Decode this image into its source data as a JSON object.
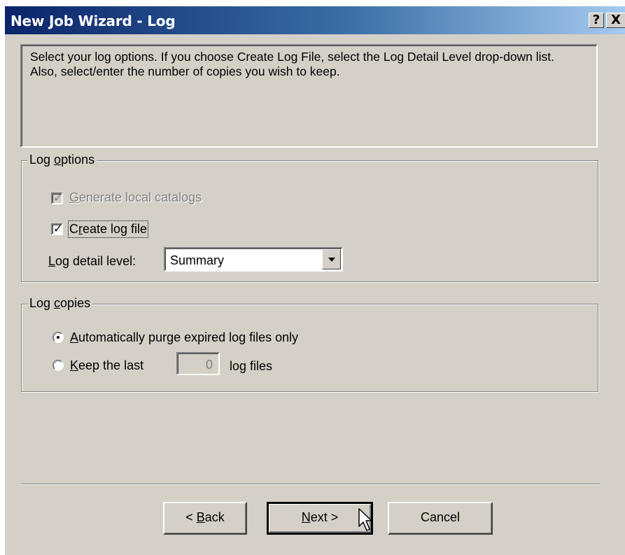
{
  "window": {
    "title": "New Job Wizard - Log",
    "help_label": "?",
    "close_label": "X"
  },
  "info": {
    "text": "Select your log options. If you choose Create Log File, select the Log Detail Level drop-down list.\nAlso, select/enter the number of copies you wish to keep."
  },
  "log_options": {
    "legend": "Log options",
    "generate_catalogs": {
      "label": "Generate local catalogs",
      "checked": true,
      "disabled": true
    },
    "create_log_file": {
      "label": "Create log file",
      "checked": true
    },
    "detail_level_label": "Log detail level:",
    "detail_level_value": "Summary"
  },
  "log_copies": {
    "legend": "Log copies",
    "option_purge": {
      "label": "Automatically purge expired log files only",
      "selected": true
    },
    "option_keep_prefix": "Keep the last",
    "keep_count": "0",
    "option_keep_suffix": "log files"
  },
  "buttons": {
    "back": "< Back",
    "next": "Next >",
    "cancel": "Cancel"
  }
}
